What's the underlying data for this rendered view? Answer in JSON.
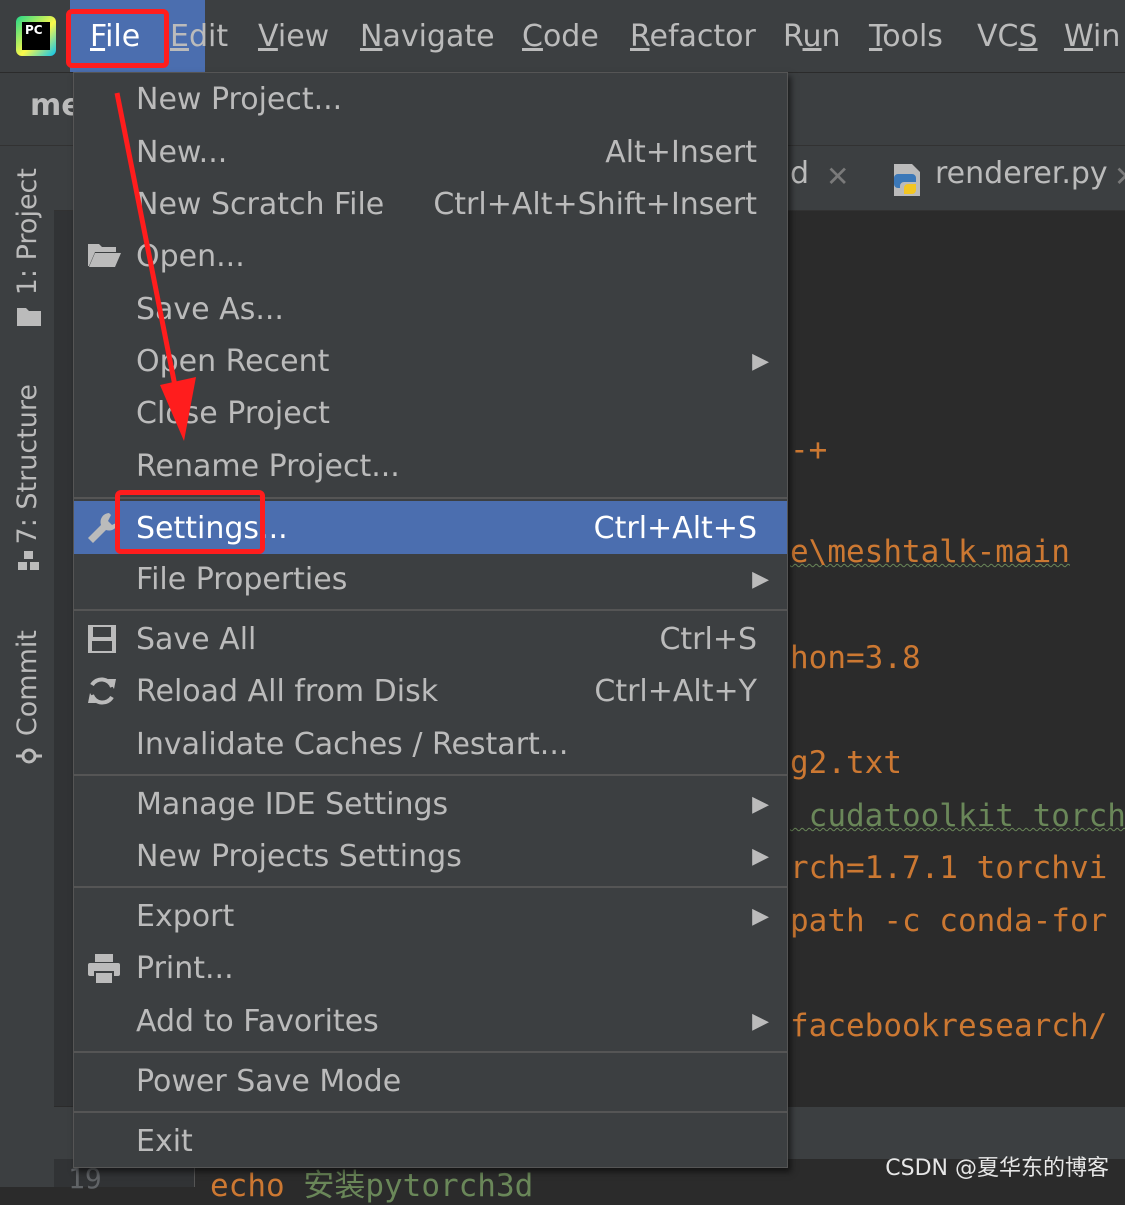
{
  "menubar": {
    "logo_text": "PC",
    "items": [
      {
        "label": "File",
        "mnemonic_index": 0
      },
      {
        "label": "Edit",
        "mnemonic_index": 0
      },
      {
        "label": "View",
        "mnemonic_index": 0
      },
      {
        "label": "Navigate",
        "mnemonic_index": 0
      },
      {
        "label": "Code",
        "mnemonic_index": 0
      },
      {
        "label": "Refactor",
        "mnemonic_index": 0
      },
      {
        "label": "Run",
        "mnemonic_index": 1
      },
      {
        "label": "Tools",
        "mnemonic_index": 0
      },
      {
        "label": "VCS",
        "mnemonic_index": 2
      },
      {
        "label": "Win",
        "mnemonic_index": 0
      }
    ]
  },
  "navbar": {
    "project_name": "me"
  },
  "side_tabs": {
    "project": "1: Project",
    "structure": "7: Structure",
    "commit": "Commit"
  },
  "editor_tabs": [
    {
      "label": "d"
    },
    {
      "label": "renderer.py"
    }
  ],
  "code_lines": [
    "-+",
    "e\\meshtalk-main",
    "hon=3.8",
    "g2.txt",
    " cudatoolkit torch",
    "rch=1.7.1 torchvi",
    "path -c conda-for",
    "facebookresearch/"
  ],
  "code_bottom": {
    "line_number": "19",
    "keyword": "echo ",
    "comment": "安装pytorch3d"
  },
  "file_menu": {
    "items": [
      {
        "label": "New Project...",
        "shortcut": "",
        "submenu": false
      },
      {
        "label": "New...",
        "shortcut": "Alt+Insert",
        "submenu": false
      },
      {
        "label": "New Scratch File",
        "shortcut": "Ctrl+Alt+Shift+Insert",
        "submenu": false
      },
      {
        "label": "Open...",
        "shortcut": "",
        "submenu": false,
        "icon": "folder-open-icon"
      },
      {
        "label": "Save As...",
        "shortcut": "",
        "submenu": false
      },
      {
        "label": "Open Recent",
        "shortcut": "",
        "submenu": true
      },
      {
        "label": "Close Project",
        "shortcut": "",
        "submenu": false
      },
      {
        "label": "Rename Project...",
        "shortcut": "",
        "submenu": false
      },
      {
        "label": "Settings...",
        "shortcut": "Ctrl+Alt+S",
        "submenu": false,
        "icon": "wrench-icon",
        "selected": true
      },
      {
        "label": "File Properties",
        "shortcut": "",
        "submenu": true
      },
      {
        "label": "Save All",
        "shortcut": "Ctrl+S",
        "submenu": false,
        "icon": "save-icon"
      },
      {
        "label": "Reload All from Disk",
        "shortcut": "Ctrl+Alt+Y",
        "submenu": false,
        "icon": "reload-icon"
      },
      {
        "label": "Invalidate Caches / Restart...",
        "shortcut": "",
        "submenu": false
      },
      {
        "label": "Manage IDE Settings",
        "shortcut": "",
        "submenu": true
      },
      {
        "label": "New Projects Settings",
        "shortcut": "",
        "submenu": true
      },
      {
        "label": "Export",
        "shortcut": "",
        "submenu": true
      },
      {
        "label": "Print...",
        "shortcut": "",
        "submenu": false,
        "icon": "printer-icon"
      },
      {
        "label": "Add to Favorites",
        "shortcut": "",
        "submenu": true
      },
      {
        "label": "Power Save Mode",
        "shortcut": "",
        "submenu": false
      },
      {
        "label": "Exit",
        "shortcut": "",
        "submenu": false
      }
    ]
  },
  "watermark": "CSDN @夏华东的博客",
  "colors": {
    "accent": "#4b6eaf",
    "annotation": "#ff1d1d",
    "menu_bg": "#3c3f41",
    "editor_bg": "#2b2b2b",
    "code_orange": "#cc7832",
    "code_green": "#6a8759"
  }
}
